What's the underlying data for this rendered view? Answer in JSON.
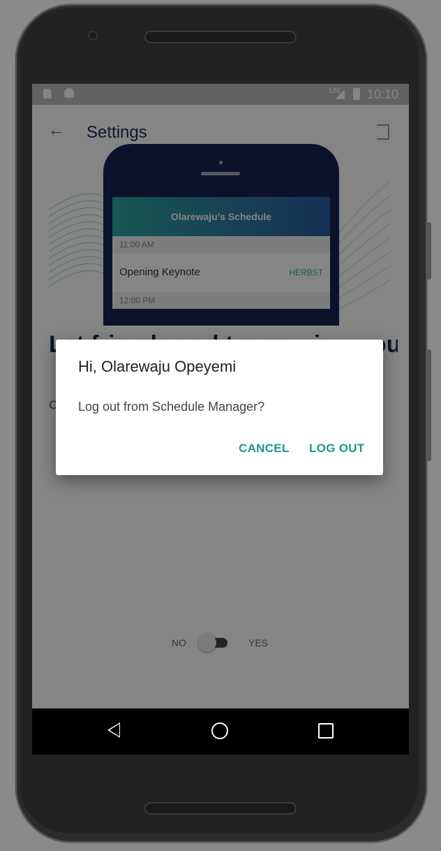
{
  "status_bar": {
    "network": "LTE",
    "time": "10:10"
  },
  "app_bar": {
    "title": "Settings"
  },
  "hero": {
    "schedule_title": "Olarewaju's Schedule",
    "slot1": "11:00 AM",
    "event": "Opening Keynote",
    "event_tag": "HERBST",
    "slot2": "12:00 PM"
  },
  "content": {
    "heading": "Let friends and teams view your",
    "body": "C                                                                                   e"
  },
  "toggle": {
    "off_label": "NO",
    "on_label": "YES",
    "value": "NO"
  },
  "dialog": {
    "title": "Hi, Olarewaju Opeyemi",
    "message": "Log out from Schedule Manager?",
    "cancel": "CANCEL",
    "logout": "LOG OUT"
  },
  "colors": {
    "accent": "#1a9a8a",
    "title": "#1a2a55",
    "scrim": "#000000"
  }
}
